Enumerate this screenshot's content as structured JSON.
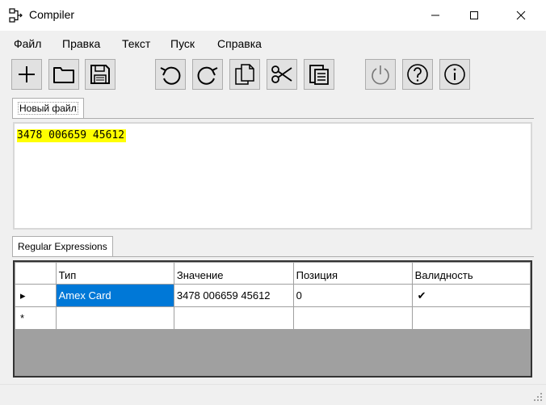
{
  "window": {
    "title": "Compiler",
    "app_icon": "flowchart-icon",
    "controls": [
      "minimize-icon",
      "maximize-icon",
      "close-icon"
    ]
  },
  "menu": {
    "items": [
      "Файл",
      "Правка",
      "Текст",
      "Пуск",
      "Справка"
    ]
  },
  "toolbar": {
    "buttons": [
      "new-icon",
      "open-folder-icon",
      "save-icon",
      "undo-icon",
      "redo-icon",
      "copy-icon",
      "cut-icon",
      "paste-icon",
      "power-icon",
      "help-icon",
      "info-icon"
    ]
  },
  "editor_tab": {
    "label": "Новый файл"
  },
  "editor": {
    "text": "3478 006659 45612",
    "highlight_color": "#ffff00"
  },
  "results_tab": {
    "label": "Regular Expressions"
  },
  "grid": {
    "columns": [
      "Тип",
      "Значение",
      "Позиция",
      "Валидность"
    ],
    "rows": [
      {
        "indicator": "▸",
        "type": "Amex Card",
        "value": "3478 006659 45612",
        "position": "0",
        "validity": "✔"
      },
      {
        "indicator": "*",
        "type": "",
        "value": "",
        "position": "",
        "validity": ""
      }
    ],
    "selection_color": "#0078d7"
  }
}
